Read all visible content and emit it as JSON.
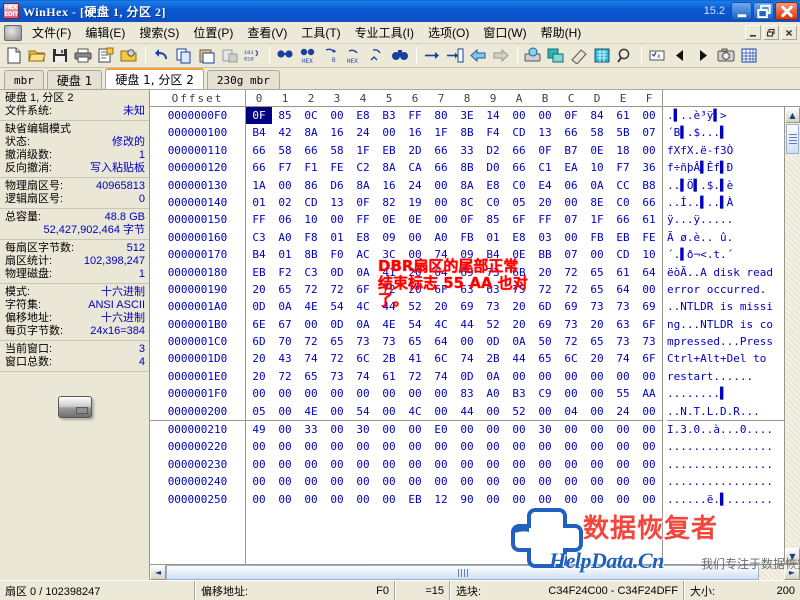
{
  "window": {
    "title": "WinHex - [硬盘 1, 分区 2]",
    "version": "15.2",
    "app_icon": "hex-logo-icon",
    "minimize": "_",
    "maximize": "❐",
    "close": "✕"
  },
  "menu": {
    "items": [
      {
        "label": "文件(F)",
        "name": "menu-file"
      },
      {
        "label": "编辑(E)",
        "name": "menu-edit"
      },
      {
        "label": "搜索(S)",
        "name": "menu-search"
      },
      {
        "label": "位置(P)",
        "name": "menu-position"
      },
      {
        "label": "查看(V)",
        "name": "menu-view"
      },
      {
        "label": "工具(T)",
        "name": "menu-tools"
      },
      {
        "label": "专业工具(I)",
        "name": "menu-specialist"
      },
      {
        "label": "选项(O)",
        "name": "menu-options"
      },
      {
        "label": "窗口(W)",
        "name": "menu-window"
      },
      {
        "label": "帮助(H)",
        "name": "menu-help"
      }
    ],
    "mdi_minimize": "_",
    "mdi_restore": "❐",
    "mdi_close": "✕"
  },
  "toolbar": {
    "buttons": [
      "new-file-icon",
      "open-file-icon",
      "save-icon",
      "print-icon",
      "properties-icon",
      "open-disk-icon",
      "undo-icon",
      "copy-icon",
      "paste-icon",
      "clipboard-data-icon",
      "convert-icon",
      "find-icon",
      "find-hex-icon",
      "replace-icon",
      "replace-hex-icon",
      "replace-all-icon",
      "binoculars-icon",
      "goto-icon",
      "goto-offset-icon",
      "back-icon",
      "forward-icon",
      "disk-tools-icon",
      "backup-icon",
      "wipe-icon",
      "calculator-icon",
      "zoom-icon",
      "checksum-icon",
      "prev-icon",
      "next-icon",
      "snapshot-icon",
      "table-icon"
    ]
  },
  "tabs": [
    {
      "label": "mbr",
      "active": false,
      "cjk": false
    },
    {
      "label": "硬盘 1",
      "active": false,
      "cjk": true
    },
    {
      "label": "硬盘 1, 分区 2",
      "active": true,
      "cjk": true
    },
    {
      "label": "230g mbr",
      "active": false,
      "cjk": false
    }
  ],
  "sidebar": {
    "groups": [
      {
        "name": "volume-group",
        "rows": [
          {
            "label": "硬盘 1, 分区 2",
            "value": "",
            "type": "title"
          },
          {
            "label": "文件系统:",
            "value": "未知"
          }
        ]
      },
      {
        "name": "edit-mode-group",
        "rows": [
          {
            "label": "缺省编辑模式",
            "value": "",
            "type": "title"
          },
          {
            "label": "状态:",
            "value": "修改的"
          },
          {
            "label": "撤消级数:",
            "value": "1"
          },
          {
            "label": "反向撤消:",
            "value": "写入粘贴板"
          }
        ]
      },
      {
        "name": "sector-group",
        "rows": [
          {
            "label": "物理扇区号:",
            "value": "40965813"
          },
          {
            "label": "逻辑扇区号:",
            "value": "0"
          }
        ]
      },
      {
        "name": "capacity-group",
        "rows": [
          {
            "label": "总容量:",
            "value": "48.8 GB"
          },
          {
            "label": "",
            "value": "52,427,902,464 字节",
            "type": "full"
          }
        ]
      },
      {
        "name": "geometry-group",
        "rows": [
          {
            "label": "每扇区字节数:",
            "value": "512"
          },
          {
            "label": "扇区统计:",
            "value": "102,398,247"
          },
          {
            "label": "物理磁盘:",
            "value": "1"
          }
        ]
      },
      {
        "name": "display-group",
        "rows": [
          {
            "label": "模式:",
            "value": "十六进制"
          },
          {
            "label": "字符集:",
            "value": "ANSI ASCII"
          },
          {
            "label": "偏移地址:",
            "value": "十六进制"
          },
          {
            "label": "每页字节数:",
            "value": "24x16=384"
          }
        ]
      },
      {
        "name": "window-group",
        "rows": [
          {
            "label": "当前窗口:",
            "value": "3"
          },
          {
            "label": "窗口总数:",
            "value": "4"
          }
        ]
      }
    ],
    "disk_icon": "hard-disk-icon"
  },
  "hex_view": {
    "offset_header": "Offset",
    "columns": [
      "0",
      "1",
      "2",
      "3",
      "4",
      "5",
      "6",
      "7",
      "8",
      "9",
      "A",
      "B",
      "C",
      "D",
      "E",
      "F"
    ],
    "rows": [
      {
        "offset": "0000000F0",
        "bytes": [
          "0F",
          "85",
          "0C",
          "00",
          "E8",
          "B3",
          "FF",
          "80",
          "3E",
          "14",
          "00",
          "00",
          "0F",
          "84",
          "61",
          "00"
        ],
        "ascii": ".\u0000..è³ÿ\u0000>..",
        "ascii_text": ".▌..è³ÿ▌>"
      },
      {
        "offset": "000000100",
        "bytes": [
          "B4",
          "42",
          "8A",
          "16",
          "24",
          "00",
          "16",
          "1F",
          "8B",
          "F4",
          "CD",
          "13",
          "66",
          "58",
          "5B",
          "07"
        ],
        "ascii_text": "´B▌.$...▌"
      },
      {
        "offset": "000000110",
        "bytes": [
          "66",
          "58",
          "66",
          "58",
          "1F",
          "EB",
          "2D",
          "66",
          "33",
          "D2",
          "66",
          "0F",
          "B7",
          "0E",
          "18",
          "00"
        ],
        "ascii_text": "fXfX.ë-f3Ò"
      },
      {
        "offset": "000000120",
        "bytes": [
          "66",
          "F7",
          "F1",
          "FE",
          "C2",
          "8A",
          "CA",
          "66",
          "8B",
          "D0",
          "66",
          "C1",
          "EA",
          "10",
          "F7",
          "36"
        ],
        "ascii_text": "f÷ñþÂ▌Êf▌Ð"
      },
      {
        "offset": "000000130",
        "bytes": [
          "1A",
          "00",
          "86",
          "D6",
          "8A",
          "16",
          "24",
          "00",
          "8A",
          "E8",
          "C0",
          "E4",
          "06",
          "0A",
          "CC",
          "B8"
        ],
        "ascii_text": "..▌Ö▌.$.▌è"
      },
      {
        "offset": "000000140",
        "bytes": [
          "01",
          "02",
          "CD",
          "13",
          "0F",
          "82",
          "19",
          "00",
          "8C",
          "C0",
          "05",
          "20",
          "00",
          "8E",
          "C0",
          "66"
        ],
        "ascii_text": "..Í..▌..▌À"
      },
      {
        "offset": "000000150",
        "bytes": [
          "FF",
          "06",
          "10",
          "00",
          "FF",
          "0E",
          "0E",
          "00",
          "0F",
          "85",
          "6F",
          "FF",
          "07",
          "1F",
          "66",
          "61"
        ],
        "ascii_text": "ÿ...ÿ....."
      },
      {
        "offset": "000000160",
        "bytes": [
          "C3",
          "A0",
          "F8",
          "01",
          "E8",
          "09",
          "00",
          "A0",
          "FB",
          "01",
          "E8",
          "03",
          "00",
          "FB",
          "EB",
          "FE"
        ],
        "ascii_text": "Ã ø.è.. û."
      },
      {
        "offset": "000000170",
        "bytes": [
          "B4",
          "01",
          "8B",
          "F0",
          "AC",
          "3C",
          "00",
          "74",
          "09",
          "B4",
          "0E",
          "BB",
          "07",
          "00",
          "CD",
          "10"
        ],
        "ascii_text": "´.▌ð¬<.t.´"
      },
      {
        "offset": "000000180",
        "bytes": [
          "EB",
          "F2",
          "C3",
          "0D",
          "0A",
          "41",
          "20",
          "64",
          "69",
          "73",
          "6B",
          "20",
          "72",
          "65",
          "61",
          "64"
        ],
        "ascii_text": "ëòÃ..A disk read"
      },
      {
        "offset": "000000190",
        "bytes": [
          "20",
          "65",
          "72",
          "72",
          "6F",
          "72",
          "20",
          "6F",
          "63",
          "63",
          "75",
          "72",
          "72",
          "65",
          "64",
          "00"
        ],
        "ascii_text": " error occurred."
      },
      {
        "offset": "0000001A0",
        "bytes": [
          "0D",
          "0A",
          "4E",
          "54",
          "4C",
          "44",
          "52",
          "20",
          "69",
          "73",
          "20",
          "6D",
          "69",
          "73",
          "73",
          "69"
        ],
        "ascii_text": "..NTLDR is missi"
      },
      {
        "offset": "0000001B0",
        "bytes": [
          "6E",
          "67",
          "00",
          "0D",
          "0A",
          "4E",
          "54",
          "4C",
          "44",
          "52",
          "20",
          "69",
          "73",
          "20",
          "63",
          "6F"
        ],
        "ascii_text": "ng...NTLDR is co"
      },
      {
        "offset": "0000001C0",
        "bytes": [
          "6D",
          "70",
          "72",
          "65",
          "73",
          "73",
          "65",
          "64",
          "00",
          "0D",
          "0A",
          "50",
          "72",
          "65",
          "73",
          "73"
        ],
        "ascii_text": "mpressed...Press"
      },
      {
        "offset": "0000001D0",
        "bytes": [
          "20",
          "43",
          "74",
          "72",
          "6C",
          "2B",
          "41",
          "6C",
          "74",
          "2B",
          "44",
          "65",
          "6C",
          "20",
          "74",
          "6F"
        ],
        "ascii_text": " Ctrl+Alt+Del to"
      },
      {
        "offset": "0000001E0",
        "bytes": [
          "20",
          "72",
          "65",
          "73",
          "74",
          "61",
          "72",
          "74",
          "0D",
          "0A",
          "00",
          "00",
          "00",
          "00",
          "00",
          "00"
        ],
        "ascii_text": " restart......"
      },
      {
        "offset": "0000001F0",
        "bytes": [
          "00",
          "00",
          "00",
          "00",
          "00",
          "00",
          "00",
          "00",
          "83",
          "A0",
          "B3",
          "C9",
          "00",
          "00",
          "55",
          "AA"
        ],
        "ascii_text": "........▌"
      },
      {
        "offset": "000000200",
        "bytes": [
          "05",
          "00",
          "4E",
          "00",
          "54",
          "00",
          "4C",
          "00",
          "44",
          "00",
          "52",
          "00",
          "04",
          "00",
          "24",
          "00"
        ],
        "ascii_text": "..N.T.L.D.R..."
      },
      {
        "offset": "000000210",
        "bytes": [
          "49",
          "00",
          "33",
          "00",
          "30",
          "00",
          "00",
          "E0",
          "00",
          "00",
          "00",
          "30",
          "00",
          "00",
          "00",
          "00"
        ],
        "ascii_text": "I.3.0..à...0...."
      },
      {
        "offset": "000000220",
        "bytes": [
          "00",
          "00",
          "00",
          "00",
          "00",
          "00",
          "00",
          "00",
          "00",
          "00",
          "00",
          "00",
          "00",
          "00",
          "00",
          "00"
        ],
        "ascii_text": "................"
      },
      {
        "offset": "000000230",
        "bytes": [
          "00",
          "00",
          "00",
          "00",
          "00",
          "00",
          "00",
          "00",
          "00",
          "00",
          "00",
          "00",
          "00",
          "00",
          "00",
          "00"
        ],
        "ascii_text": "................"
      },
      {
        "offset": "000000240",
        "bytes": [
          "00",
          "00",
          "00",
          "00",
          "00",
          "00",
          "00",
          "00",
          "00",
          "00",
          "00",
          "00",
          "00",
          "00",
          "00",
          "00"
        ],
        "ascii_text": "................"
      },
      {
        "offset": "000000250",
        "bytes": [
          "00",
          "00",
          "00",
          "00",
          "00",
          "00",
          "EB",
          "12",
          "90",
          "00",
          "00",
          "00",
          "00",
          "00",
          "00",
          "00"
        ],
        "ascii_text": "......ë.▌......."
      }
    ],
    "sector_break_after_row": 17,
    "cursor_byte_row": 0,
    "cursor_byte_col": 0
  },
  "annotation": {
    "line1": "DBR扇区的尾部正常",
    "line2": "结束标志 55 AA 也对",
    "line3": "了。",
    "color": "#ff0000"
  },
  "watermark": {
    "red_text": "数据恢复者",
    "brand": "HelpData.Cn",
    "tagline": "我们专注于数据恢复",
    "cross_icon": "medical-cross-logo-icon",
    "brand_color": "#1f5fbf",
    "red_color": "#f4463c"
  },
  "scrollbars": {
    "v_up": "▲",
    "v_down": "▼",
    "h_left": "◄",
    "h_right": "►"
  },
  "statusbar": {
    "sector": "扇区 0 / 102398247",
    "offset_label": "偏移地址:",
    "offset_value": "F0",
    "equals": "=15",
    "block_label": "选块:",
    "block_value": "C34F24C00 - C34F24DFF",
    "size_label": "大小:",
    "size_value": "200"
  }
}
